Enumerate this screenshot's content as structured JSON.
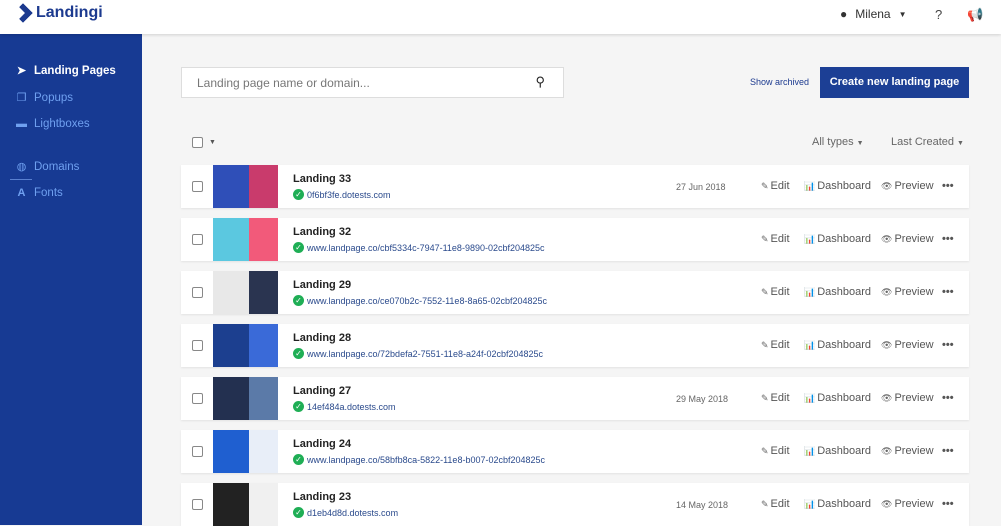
{
  "app": {
    "name": "Landingi"
  },
  "header": {
    "user": "Milena",
    "help": "?"
  },
  "sidebar": {
    "items": [
      {
        "label": "Landing Pages",
        "icon": "paper-plane-icon",
        "active": true
      },
      {
        "label": "Popups",
        "icon": "popups-icon"
      },
      {
        "label": "Lightboxes",
        "icon": "lightbox-icon"
      },
      {
        "label": "Domains",
        "icon": "globe-icon"
      },
      {
        "label": "Fonts",
        "icon": "font-icon"
      }
    ]
  },
  "search": {
    "placeholder": "Landing page name or domain..."
  },
  "toolbar": {
    "show_archived": "Show archived",
    "create": "Create new landing page",
    "type_filter": "All types",
    "sort": "Last Created"
  },
  "actions": {
    "edit": "Edit",
    "dashboard": "Dashboard",
    "preview": "Preview"
  },
  "rows": [
    {
      "name": "Landing 33",
      "url": "0f6bf3fe.dotests.com",
      "date": "27 Jun 2018",
      "thumb": [
        "#2f4fb8",
        "#c93b6c"
      ]
    },
    {
      "name": "Landing 32",
      "url": "www.landpage.co/cbf5334c-7947-11e8-9890-02cbf204825c",
      "date": "",
      "thumb": [
        "#5bc8e0",
        "#f25a7a"
      ]
    },
    {
      "name": "Landing 29",
      "url": "www.landpage.co/ce070b2c-7552-11e8-8a65-02cbf204825c",
      "date": "",
      "thumb": [
        "#e8e8e8",
        "#2a3450"
      ]
    },
    {
      "name": "Landing 28",
      "url": "www.landpage.co/72bdefa2-7551-11e8-a24f-02cbf204825c",
      "date": "",
      "thumb": [
        "#1c3f8f",
        "#3a6ad8"
      ]
    },
    {
      "name": "Landing 27",
      "url": "14ef484a.dotests.com",
      "date": "29 May 2018",
      "thumb": [
        "#233050",
        "#5b7aa8"
      ]
    },
    {
      "name": "Landing 24",
      "url": "www.landpage.co/58bfb8ca-5822-11e8-b007-02cbf204825c",
      "date": "",
      "thumb": [
        "#1f5fd0",
        "#e8eef8"
      ]
    },
    {
      "name": "Landing 23",
      "url": "d1eb4d8d.dotests.com",
      "date": "14 May 2018",
      "thumb": [
        "#222222",
        "#f0f0f0"
      ]
    }
  ]
}
